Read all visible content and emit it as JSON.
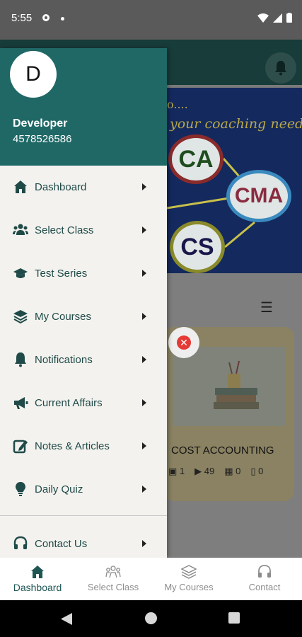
{
  "status_bar": {
    "time": "5:55"
  },
  "background": {
    "banner_dots": "o....",
    "banner_text": "your coaching needs.....",
    "bubbles": [
      "CA",
      "CMA",
      "CS"
    ],
    "course": {
      "title": "COST ACCOUNTING",
      "stats": [
        "1",
        "49",
        "0",
        "0"
      ]
    }
  },
  "drawer": {
    "avatar_letter": "D",
    "user_name": "Developer",
    "user_phone": "4578526586",
    "items": [
      {
        "label": "Dashboard",
        "icon": "home-icon"
      },
      {
        "label": "Select Class",
        "icon": "people-icon"
      },
      {
        "label": "Test Series",
        "icon": "graduation-cap-icon"
      },
      {
        "label": "My Courses",
        "icon": "layers-icon"
      },
      {
        "label": "Notifications",
        "icon": "bell-icon"
      },
      {
        "label": "Current Affairs",
        "icon": "megaphone-icon"
      },
      {
        "label": "Notes & Articles",
        "icon": "edit-icon"
      },
      {
        "label": "Daily Quiz",
        "icon": "lightbulb-icon"
      },
      {
        "label": "Contact Us",
        "icon": "headset-icon"
      }
    ]
  },
  "bottom_nav": [
    {
      "label": "Dashboard",
      "icon": "home-icon",
      "active": true
    },
    {
      "label": "Select Class",
      "icon": "people-icon",
      "active": false
    },
    {
      "label": "My Courses",
      "icon": "layers-icon",
      "active": false
    },
    {
      "label": "Contact",
      "icon": "headset-icon",
      "active": false
    }
  ],
  "colors": {
    "drawer_header": "#1f6866",
    "accent": "#1f4a48",
    "drawer_bg": "#f3f2ee"
  }
}
